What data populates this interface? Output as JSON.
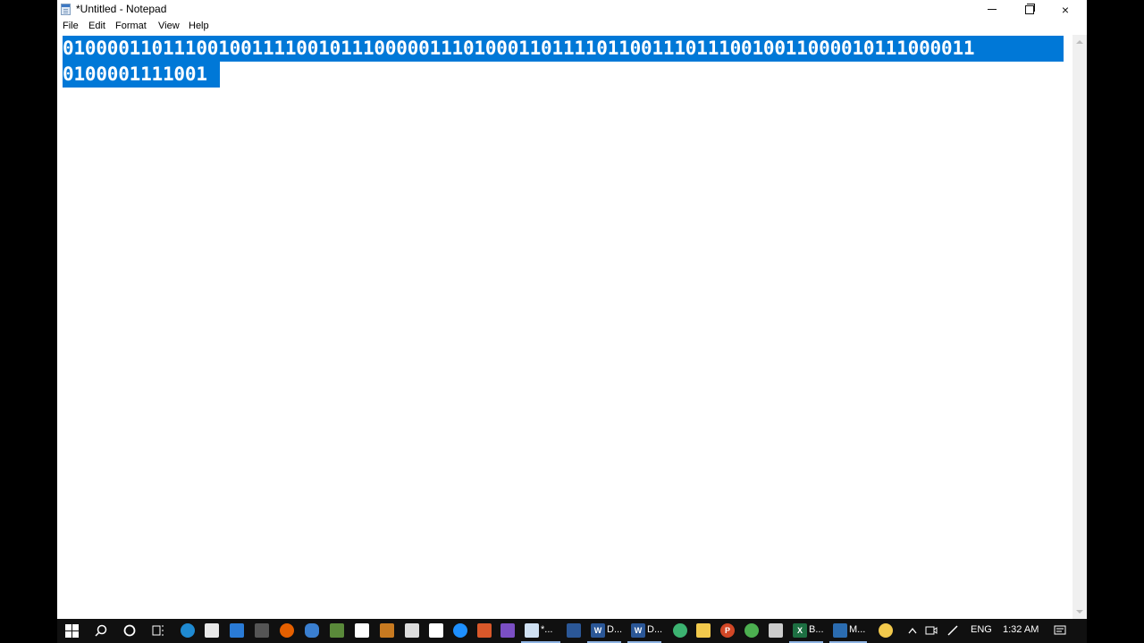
{
  "window": {
    "title": "*Untitled - Notepad",
    "app_icon": "notepad-icon",
    "controls": {
      "minimize": "minimize-icon",
      "maximize": "restore-icon",
      "close": "×"
    }
  },
  "menu": {
    "items": [
      "File",
      "Edit",
      "Format",
      "View",
      "Help"
    ]
  },
  "editor": {
    "lines": [
      "0100001101110010011110010111000001110100011011110110011101110010011000010111000011",
      "0100001111001"
    ],
    "selection_color": "#0078d7"
  },
  "taskbar": {
    "icons": [
      "windows-start-icon",
      "search-icon",
      "cortana-icon",
      "task-view-icon",
      "edge-icon",
      "store-icon",
      "mail-icon",
      "film-icon",
      "firefox-icon",
      "onedrive-icon",
      "camera-icon",
      "photo-icon",
      "docbox-icon",
      "magnifier-icon",
      "app-icon",
      "teamviewer-icon",
      "matlab-icon",
      "visual-studio-icon"
    ],
    "running": [
      {
        "icon": "notepad-icon",
        "label": "*..."
      },
      {
        "icon": "defender-icon",
        "label": ""
      },
      {
        "icon": "word-icon",
        "label": "D..."
      },
      {
        "icon": "word-icon",
        "label": "D..."
      },
      {
        "icon": "green-app-icon",
        "label": ""
      },
      {
        "icon": "folder-icon",
        "label": ""
      },
      {
        "icon": "powerpoint-icon",
        "label": ""
      },
      {
        "icon": "chrome-icon",
        "label": ""
      },
      {
        "icon": "app2-icon",
        "label": ""
      },
      {
        "icon": "excel-icon",
        "label": "B..."
      },
      {
        "icon": "monitor-icon",
        "label": "M..."
      }
    ],
    "tray": {
      "language": "ENG",
      "time": "1:32 AM"
    }
  }
}
